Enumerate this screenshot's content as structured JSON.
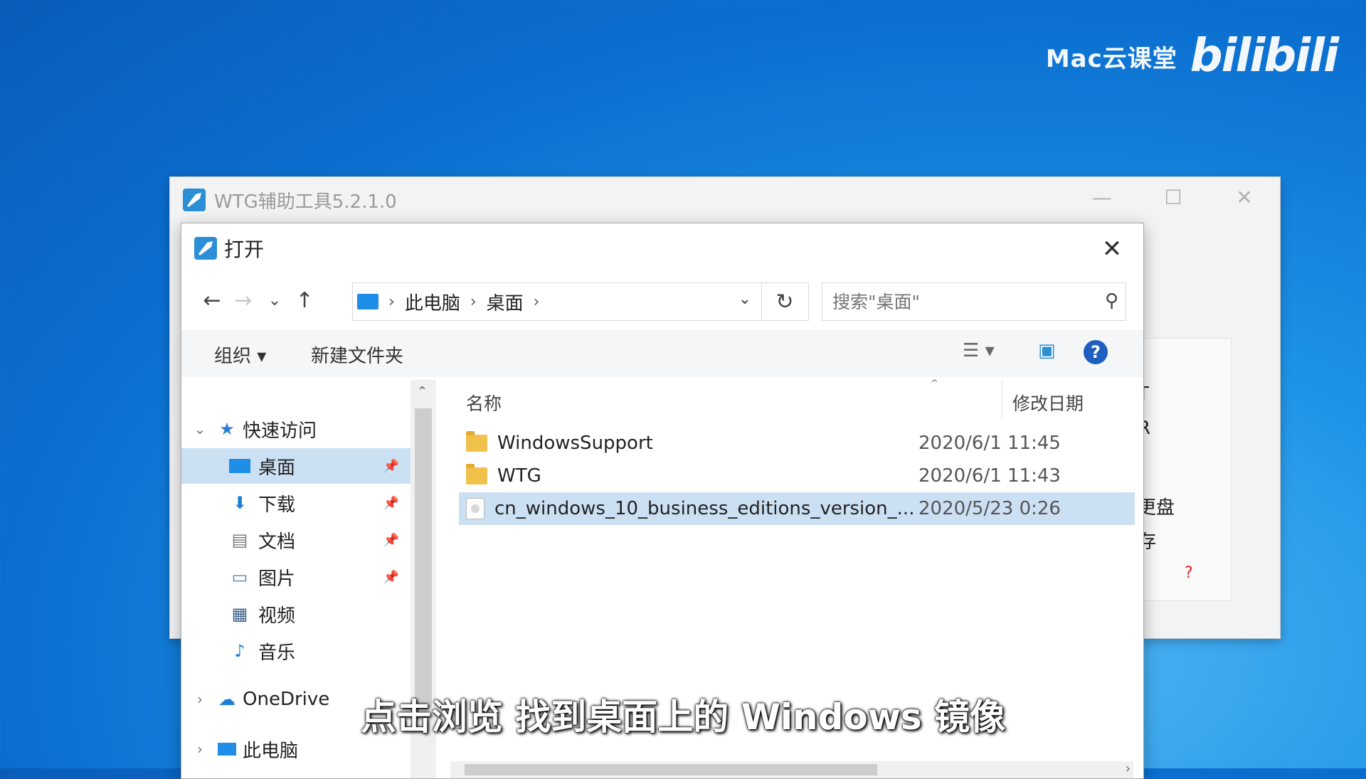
{
  "watermark": {
    "text": "Mac云课堂",
    "logo": "bilibili"
  },
  "wtg_window": {
    "title": "WTG辅助工具5.2.1.0",
    "peek_texts": [
      "T",
      "R",
      "更盘",
      "存"
    ],
    "help_mark": "?",
    "controls": {
      "minimize": "—",
      "maximize": "☐",
      "close": "✕"
    }
  },
  "dialog": {
    "title": "打开",
    "close": "✕",
    "nav": {
      "back": "←",
      "forward": "→",
      "recent": "⌄",
      "up": "↑",
      "refresh": "↻"
    },
    "breadcrumb": [
      "此电脑",
      "桌面"
    ],
    "search_placeholder": "搜索\"桌面\"",
    "toolbar": {
      "organize": "组织 ▾",
      "new_folder": "新建文件夹",
      "help": "?"
    },
    "sidebar": {
      "quick_access": "快速访问",
      "items": [
        {
          "label": "桌面",
          "pinned": true,
          "selected": true
        },
        {
          "label": "下载",
          "pinned": true
        },
        {
          "label": "文档",
          "pinned": true
        },
        {
          "label": "图片",
          "pinned": true
        },
        {
          "label": "视频"
        },
        {
          "label": "音乐"
        }
      ],
      "onedrive": "OneDrive",
      "this_pc": "此电脑"
    },
    "columns": {
      "name": "名称",
      "date": "修改日期"
    },
    "files": [
      {
        "name": "WindowsSupport",
        "date": "2020/6/1 11:45",
        "type": "folder"
      },
      {
        "name": "WTG",
        "date": "2020/6/1 11:43",
        "type": "folder"
      },
      {
        "name": "cn_windows_10_business_editions_version_...",
        "date": "2020/5/23 0:26",
        "type": "iso",
        "selected": true
      }
    ]
  },
  "subtitle": "点击浏览 找到桌面上的 Windows 镜像"
}
